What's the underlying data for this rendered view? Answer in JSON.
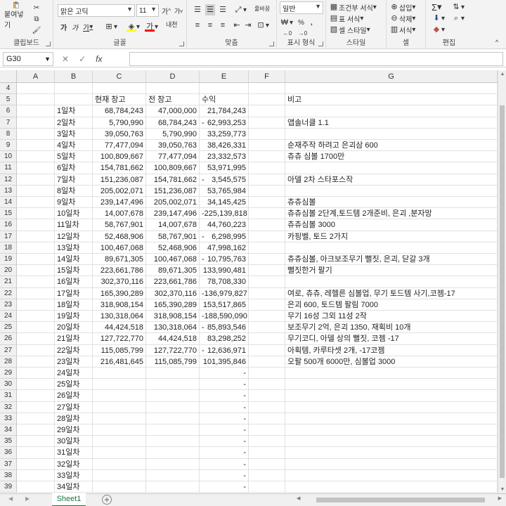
{
  "ribbon": {
    "clipboard": {
      "paste_label": "붙여넣기",
      "group_label": "클립보드"
    },
    "font": {
      "font_name": "맑은 고딕",
      "font_size": "11",
      "grow": "가",
      "shrink": "가",
      "bold": "가",
      "italic": "가",
      "underline": "가",
      "group_label": "글꼴",
      "phonetic": "내천",
      "font_color_letter": "가"
    },
    "alignment": {
      "wrap_label": "줄바꿈",
      "group_label": "맞춤"
    },
    "number": {
      "format": "일반",
      "percent": "%",
      "comma": ",",
      "group_label": "표시 형식"
    },
    "styles": {
      "conditional": "조건부 서식",
      "table": "표 서식",
      "cell_styles": "셀 스타일",
      "group_label": "스타일"
    },
    "cells": {
      "insert": "삽입",
      "delete": "삭제",
      "format": "서식",
      "group_label": "셀"
    },
    "editing": {
      "sum_icon": "sigma-icon",
      "group_label": "편집"
    }
  },
  "formula_bar": {
    "name_box": "G30",
    "fx": "fx",
    "cancel": "✕",
    "enter": "✓",
    "content": ""
  },
  "columns": [
    "A",
    "B",
    "C",
    "D",
    "E",
    "F",
    "G"
  ],
  "rows": [
    {
      "n": "4",
      "b": "",
      "c": "",
      "d": "",
      "e": "",
      "neg": false,
      "g": ""
    },
    {
      "n": "5",
      "b": "",
      "c": "현재 창고",
      "d": "전 창고",
      "e": "수익",
      "neg": false,
      "g": "비고"
    },
    {
      "n": "6",
      "b": "1일차",
      "c": "68,784,243",
      "d": "47,000,000",
      "e": "21,784,243",
      "neg": false,
      "g": ""
    },
    {
      "n": "7",
      "b": "2일차",
      "c": "5,790,990",
      "d": "68,784,243",
      "e": "62,993,253",
      "neg": true,
      "g": "앱솔너클 1.1"
    },
    {
      "n": "8",
      "b": "3일차",
      "c": "39,050,763",
      "d": "5,790,990",
      "e": "33,259,773",
      "neg": false,
      "g": ""
    },
    {
      "n": "9",
      "b": "4일차",
      "c": "77,477,094",
      "d": "39,050,763",
      "e": "38,426,331",
      "neg": false,
      "g": "순재주작 하려고 은괴삼 600"
    },
    {
      "n": "10",
      "b": "5일차",
      "c": "100,809,667",
      "d": "77,477,094",
      "e": "23,332,573",
      "neg": false,
      "g": "츄츄 심볼 1700만"
    },
    {
      "n": "11",
      "b": "6일차",
      "c": "154,781,662",
      "d": "100,809,667",
      "e": "53,971,995",
      "neg": false,
      "g": ""
    },
    {
      "n": "12",
      "b": "7일차",
      "c": "151,236,087",
      "d": "154,781,662",
      "e": "3,545,575",
      "neg": true,
      "g": "아델 2차 스타포스작"
    },
    {
      "n": "13",
      "b": "8일차",
      "c": "205,002,071",
      "d": "151,236,087",
      "e": "53,765,984",
      "neg": false,
      "g": ""
    },
    {
      "n": "14",
      "b": "9일차",
      "c": "239,147,496",
      "d": "205,002,071",
      "e": "34,145,425",
      "neg": false,
      "g": "츄츄심볼"
    },
    {
      "n": "15",
      "b": "10일차",
      "c": "14,007,678",
      "d": "239,147,496",
      "e": "-225,139,818",
      "neg": false,
      "g": "츄츄심볼 2단계,토드템 2개준비, 은괴 ,분자망"
    },
    {
      "n": "16",
      "b": "11일차",
      "c": "58,767,901",
      "d": "14,007,678",
      "e": "44,760,223",
      "neg": false,
      "g": "츄츄심볼 3000"
    },
    {
      "n": "17",
      "b": "12일차",
      "c": "52,468,906",
      "d": "58,767,901",
      "e": "6,298,995",
      "neg": true,
      "g": "카핑벨, 토드 2가지"
    },
    {
      "n": "18",
      "b": "13일차",
      "c": "100,467,068",
      "d": "52,468,906",
      "e": "47,998,162",
      "neg": false,
      "g": ""
    },
    {
      "n": "19",
      "b": "14일차",
      "c": "89,671,305",
      "d": "100,467,068",
      "e": "10,795,763",
      "neg": true,
      "g": "츄츄심볼, 아크보조무기 뻘짓, 은괴, 닫갈 3개"
    },
    {
      "n": "20",
      "b": "15일차",
      "c": "223,661,786",
      "d": "89,671,305",
      "e": "133,990,481",
      "neg": false,
      "g": "뻘짓한거 팔기"
    },
    {
      "n": "21",
      "b": "16일차",
      "c": "302,370,116",
      "d": "223,661,786",
      "e": "78,708,330",
      "neg": false,
      "g": ""
    },
    {
      "n": "22",
      "b": "17일차",
      "c": "165,390,289",
      "d": "302,370,116",
      "e": "-136,979,827",
      "neg": false,
      "g": "여로, 츄츄, 레헬른 심볼업, 무기 토드템 사기,코젬-17"
    },
    {
      "n": "23",
      "b": "18일차",
      "c": "318,908,154",
      "d": "165,390,289",
      "e": "153,517,865",
      "neg": false,
      "g": "은괴 600, 토드템 팔림 7000"
    },
    {
      "n": "24",
      "b": "19일차",
      "c": "130,318,064",
      "d": "318,908,154",
      "e": "-188,590,090",
      "neg": false,
      "g": "무기 16성 그외 11성 2작"
    },
    {
      "n": "25",
      "b": "20일차",
      "c": "44,424,518",
      "d": "130,318,064",
      "e": "85,893,546",
      "neg": true,
      "g": "보조무기 2억, 은괴 1350, 재획비 10개"
    },
    {
      "n": "26",
      "b": "21일차",
      "c": "127,722,770",
      "d": "44,424,518",
      "e": "83,298,252",
      "neg": false,
      "g": "무기코디, 아델 상의 뻘짓, 코젬 -17"
    },
    {
      "n": "27",
      "b": "22일차",
      "c": "115,085,799",
      "d": "127,722,770",
      "e": "12,636,971",
      "neg": true,
      "g": "아획템, 카루타셋 2개, -17코젬"
    },
    {
      "n": "28",
      "b": "23일차",
      "c": "216,481,645",
      "d": "115,085,799",
      "e": "101,395,846",
      "neg": false,
      "g": "오팔 500개 6000만, 심볼업 3000"
    },
    {
      "n": "29",
      "b": "24일차",
      "c": "",
      "d": "",
      "e": "-",
      "neg": false,
      "g": ""
    },
    {
      "n": "30",
      "b": "25일차",
      "c": "",
      "d": "",
      "e": "-",
      "neg": false,
      "g": ""
    },
    {
      "n": "31",
      "b": "26일차",
      "c": "",
      "d": "",
      "e": "-",
      "neg": false,
      "g": ""
    },
    {
      "n": "32",
      "b": "27일차",
      "c": "",
      "d": "",
      "e": "-",
      "neg": false,
      "g": ""
    },
    {
      "n": "33",
      "b": "28일차",
      "c": "",
      "d": "",
      "e": "-",
      "neg": false,
      "g": ""
    },
    {
      "n": "34",
      "b": "29일차",
      "c": "",
      "d": "",
      "e": "-",
      "neg": false,
      "g": ""
    },
    {
      "n": "35",
      "b": "30일차",
      "c": "",
      "d": "",
      "e": "-",
      "neg": false,
      "g": ""
    },
    {
      "n": "36",
      "b": "31일차",
      "c": "",
      "d": "",
      "e": "-",
      "neg": false,
      "g": ""
    },
    {
      "n": "37",
      "b": "32일차",
      "c": "",
      "d": "",
      "e": "-",
      "neg": false,
      "g": ""
    },
    {
      "n": "38",
      "b": "33일차",
      "c": "",
      "d": "",
      "e": "-",
      "neg": false,
      "g": ""
    },
    {
      "n": "39",
      "b": "34일차",
      "c": "",
      "d": "",
      "e": "-",
      "neg": false,
      "g": ""
    }
  ],
  "sheet_tabs": {
    "active": "Sheet1",
    "add": "+"
  },
  "accent_color": "#217346"
}
